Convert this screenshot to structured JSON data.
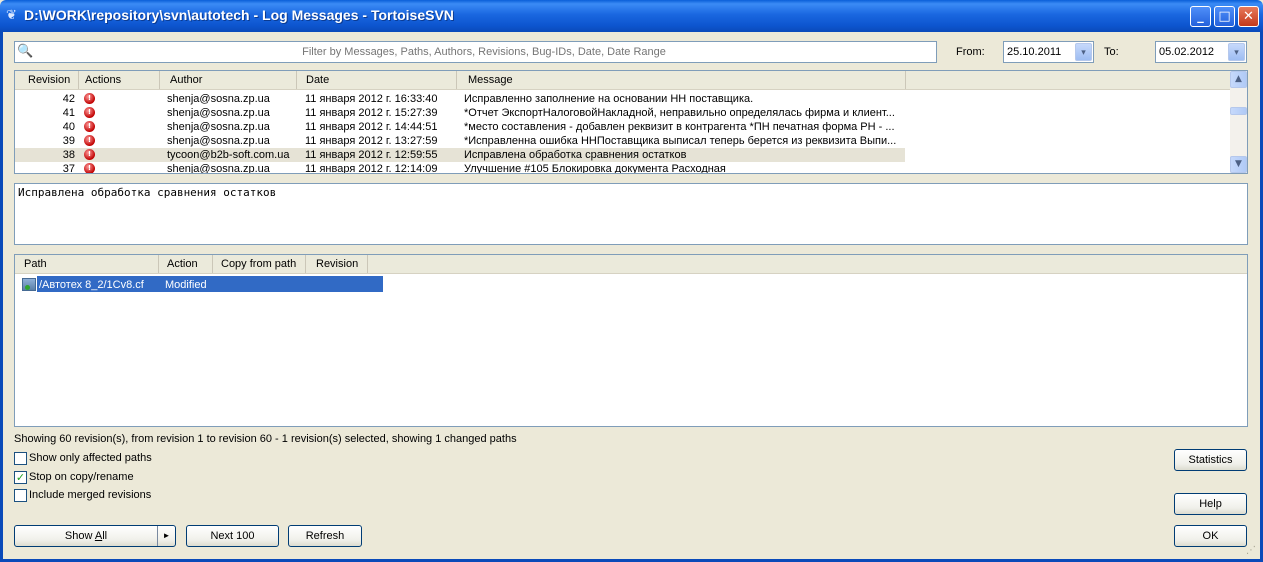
{
  "window": {
    "title": "D:\\WORK\\repository\\svn\\autotech - Log Messages - TortoiseSVN",
    "icon": "tortoise-icon",
    "minimize_glyph": "_",
    "maximize_glyph": "□",
    "close_glyph": "✕"
  },
  "filter": {
    "placeholder": "Filter by Messages, Paths, Authors, Revisions, Bug-IDs, Date, Date Range",
    "value": "",
    "icon": "search-icon"
  },
  "date_range": {
    "from_label": "From:",
    "from_value": "25.10.2011",
    "to_label": "To:",
    "to_value": "05.02.2012",
    "dropdown_glyph": "▾"
  },
  "log": {
    "columns": [
      "Revision",
      "Actions",
      "Author",
      "Date",
      "Message"
    ],
    "rows": [
      {
        "revision": "42",
        "author": "shenja@sosna.zp.ua",
        "date": "11 января 2012 г. 16:33:40",
        "message": "Исправленно заполнение на основании  НН поставщика.",
        "selected": false
      },
      {
        "revision": "41",
        "author": "shenja@sosna.zp.ua",
        "date": "11 января 2012 г. 15:27:39",
        "message": "*Отчет ЭкспортНалоговойНакладной, неправильно определялась фирма и клиент...",
        "selected": false
      },
      {
        "revision": "40",
        "author": "shenja@sosna.zp.ua",
        "date": "11 января 2012 г. 14:44:51",
        "message": "*место составления - добавлен реквизит в контрагента *ПН печатная форма РН - ...",
        "selected": false
      },
      {
        "revision": "39",
        "author": "shenja@sosna.zp.ua",
        "date": "11 января 2012 г. 13:27:59",
        "message": "*Исправленна ошибка ННПоставщика выписал теперь берется из реквизита Выпи...",
        "selected": false
      },
      {
        "revision": "38",
        "author": "tycoon@b2b-soft.com.ua",
        "date": "11 января 2012 г. 12:59:55",
        "message": "Исправлена обработка сравнения остатков",
        "selected": true
      },
      {
        "revision": "37",
        "author": "shenja@sosna.zp.ua",
        "date": "11 января 2012 г. 12:14:09",
        "message": "Улучшение #105 Блокировка документа Расходная",
        "selected": false
      }
    ],
    "scroll_up_glyph": "▲",
    "scroll_down_glyph": "▼"
  },
  "message": {
    "text": "Исправлена обработка сравнения остатков"
  },
  "paths": {
    "columns": [
      "Path",
      "Action",
      "Copy from path",
      "Revision"
    ],
    "rows": [
      {
        "path": "/Автотех 8_2/1Cv8.cf",
        "action": "Modified",
        "copy_from": "",
        "revision": "",
        "selected": true
      }
    ]
  },
  "status": {
    "text": "Showing 60 revision(s), from revision 1 to revision 60 - 1 revision(s) selected, showing 1 changed paths"
  },
  "options": {
    "show_only_affected": {
      "label": "Show only affected paths",
      "checked": false
    },
    "stop_on_copy": {
      "label": "Stop on copy/rename",
      "checked": true,
      "check_glyph": "✓"
    },
    "include_merged": {
      "label": "Include merged revisions",
      "checked": false
    }
  },
  "buttons": {
    "show_all_pre": "Show ",
    "show_all_ul": "A",
    "show_all_post": "ll",
    "show_all_arrow": "►",
    "next_100": "Next 100",
    "refresh": "Refresh",
    "statistics": "Statistics",
    "help": "Help",
    "ok": "OK"
  },
  "colors": {
    "titlebar": "#0a5fd8",
    "selection": "#316ac5",
    "selected_row": "#e6e3d6",
    "dialog_bg": "#ece9d8"
  }
}
